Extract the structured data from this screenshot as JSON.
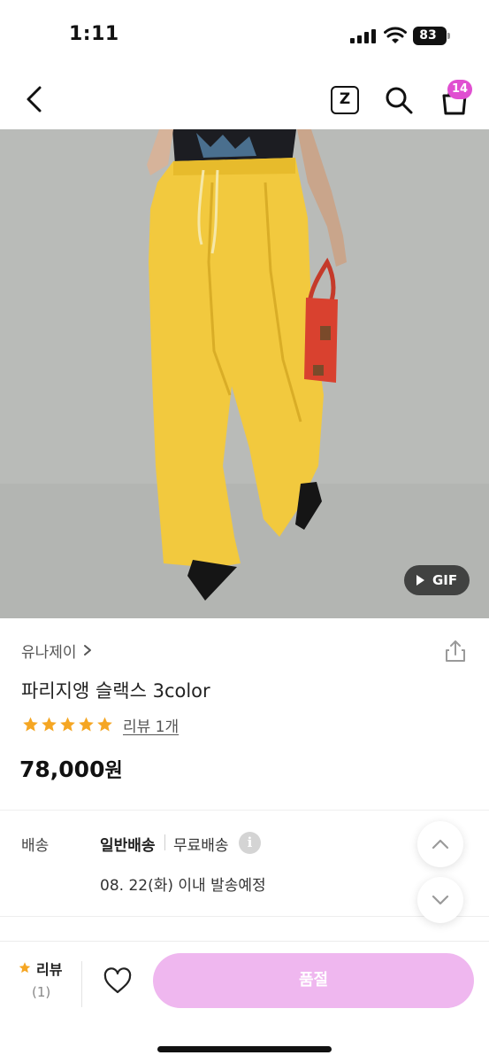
{
  "status_bar": {
    "time": "1:11",
    "battery": "83"
  },
  "nav": {
    "z_label": "Z",
    "cart_count": "14"
  },
  "hero": {
    "badge": "GIF"
  },
  "product": {
    "brand": "유나제이",
    "title": "파리지앵 슬랙스 3color",
    "rating": 5,
    "review_link": "리뷰 1개",
    "price": "78,000",
    "price_unit": "원"
  },
  "shipping": {
    "label": "배송",
    "type": "일반배송",
    "fee": "무료배송",
    "info_icon": "i",
    "date": "08. 22(화) 이내 발송예정"
  },
  "bottom_bar": {
    "review_label": "리뷰",
    "review_count": "(1)",
    "soldout_label": "품절"
  },
  "colors": {
    "accent_pink": "#e04fd1",
    "soldout_button": "#efb7ef",
    "star": "#f5a623"
  },
  "icons": {
    "back": "chevron-left-icon",
    "search": "search-icon",
    "cart": "shopping-bag-icon",
    "share": "share-icon",
    "wish": "heart-icon"
  }
}
